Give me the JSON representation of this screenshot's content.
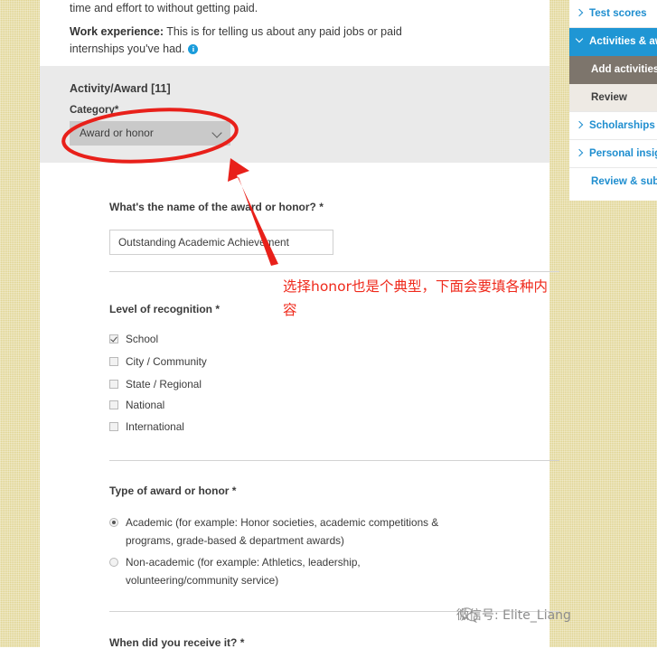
{
  "intro": {
    "line1": "time and effort to without getting paid.",
    "line2_bold": "Work experience:",
    "line2_rest": " This is for telling us about any paid jobs or paid internships you've had.",
    "info_icon": "info-icon"
  },
  "activity_panel": {
    "title": "Activity/Award [11]",
    "category_label": "Category*",
    "category_value": "Award or honor",
    "chevron_icon": "chevron-down-icon"
  },
  "name_field": {
    "label": "What's the name of the award or honor? *",
    "value": "Outstanding Academic Achievement"
  },
  "level_of_recognition": {
    "label": "Level of recognition *",
    "options": [
      {
        "label": "School",
        "checked": true
      },
      {
        "label": "City / Community",
        "checked": false
      },
      {
        "label": "State / Regional",
        "checked": false
      },
      {
        "label": "National",
        "checked": false
      },
      {
        "label": "International",
        "checked": false
      }
    ]
  },
  "type_of_award": {
    "label": "Type of award or honor *",
    "options": [
      {
        "line1": "Academic (for example: Honor societies, academic competitions &",
        "line2": "programs, grade-based & department awards)",
        "selected": true
      },
      {
        "line1": "Non-academic (for example: Athletics, leadership,",
        "line2": "volunteering/community service)",
        "selected": false
      }
    ]
  },
  "date_field": {
    "label": "When did you receive it? *"
  },
  "sidebar": {
    "items": [
      {
        "label": "Test scores",
        "icon": "chevron-right-icon",
        "state": "collapsed"
      },
      {
        "label": "Activities & aw",
        "icon": "chevron-down-icon",
        "state": "active"
      },
      {
        "label": "Add activities &",
        "icon": "",
        "state": "sub-active"
      },
      {
        "label": "Review",
        "icon": "",
        "state": "sub"
      },
      {
        "label": "Scholarships &",
        "icon": "chevron-right-icon",
        "state": "collapsed"
      },
      {
        "label": "Personal insigh",
        "icon": "chevron-right-icon",
        "state": "collapsed"
      },
      {
        "label": "Review & subm",
        "icon": "",
        "state": "plain"
      }
    ]
  },
  "annotation": {
    "text": "选择honor也是个典型，下面会要填各种内容",
    "color": "#ef2a1c",
    "arrow_icon": "arrow-up-left-icon",
    "ellipse_icon": "ellipse-highlight-icon"
  },
  "watermark": {
    "text": "微信号: Elite_Liang",
    "icon": "wechat-icon"
  },
  "colors": {
    "accent_blue": "#1f96d4",
    "sub_active_gray": "#7d756c",
    "panel_gray": "#eaeaea",
    "select_gray": "#c9c9c9",
    "page_bg": "#e0d492",
    "annotation_red": "#ef2a1c"
  }
}
